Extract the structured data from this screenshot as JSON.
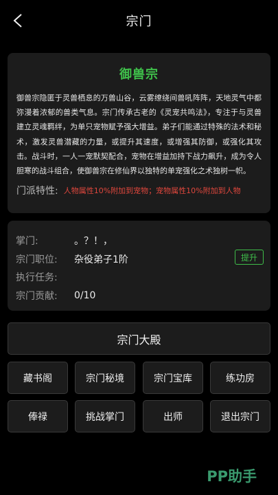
{
  "header": {
    "title": "宗门"
  },
  "sect": {
    "name": "御兽宗",
    "description": "御兽宗隐匿于灵兽栖息的万兽山谷，云雾缭绕间兽吼阵阵，天地灵气中都弥漫着浓郁的兽类气息。宗门传承古老的《灵宠共鸣法》，专注于与灵兽建立灵魂羁绊，为单只宠物赋予强大增益。弟子们能通过特殊的法术和秘术，激发灵兽潜藏的力量，或提升其速度，或增强其防御，或强化其攻击。战斗时，一人一宠默契配合，宠物在增益加持下战力飙升，成为令人胆寒的战斗组合，使御兽宗在修仙界以独特的单宠强化之术独树一帜。",
    "trait_label": "门派特性:",
    "trait_value": "人物属性10%附加到宠物；宠物属性10%附加到人物"
  },
  "info": {
    "leader_label": "掌门:",
    "leader_value": "。？！，",
    "position_label": "宗门职位:",
    "position_value": "杂役弟子1阶",
    "promote_label": "提升",
    "task_label": "执行任务:",
    "task_value": "",
    "contribution_label": "宗门贡献:",
    "contribution_value": "0/10"
  },
  "hall_button": "宗门大殿",
  "grid": [
    "藏书阁",
    "宗门秘境",
    "宗门宝库",
    "练功房",
    "俸禄",
    "挑战掌门",
    "出师",
    "退出宗门"
  ],
  "watermark": "PP助手",
  "colors": {
    "accent_green": "#3fbf4a",
    "trait_red": "#e0473d",
    "card_bg": "#1c1c1c",
    "page_bg": "#000000"
  }
}
